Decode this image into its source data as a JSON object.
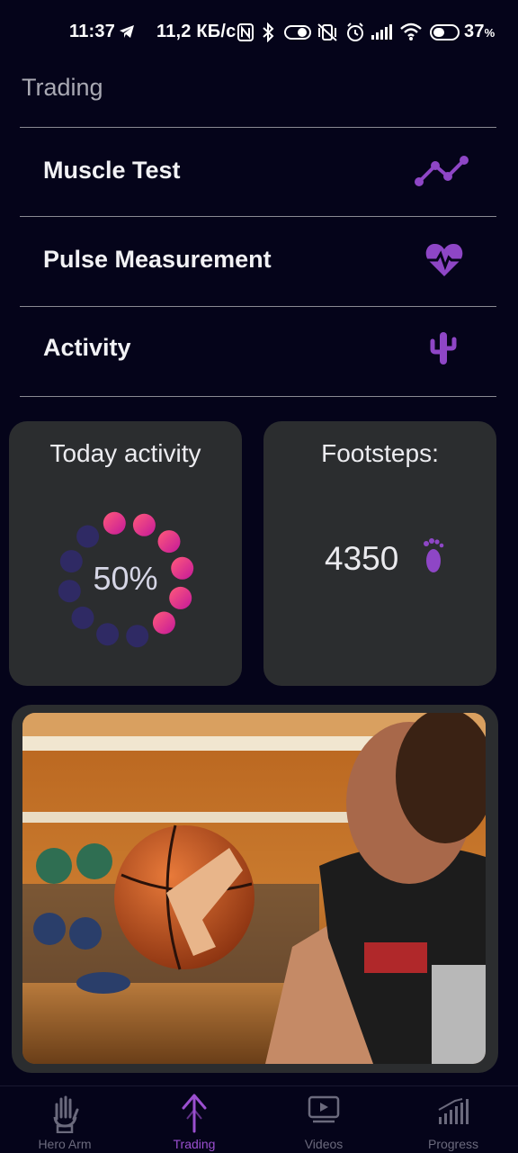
{
  "status_bar": {
    "time": "11:37",
    "network_speed": "11,2 КБ/с",
    "battery": "37",
    "battery_unit": "%"
  },
  "section_title": "Trading",
  "menu": [
    {
      "label": "Muscle Test",
      "icon": "chart-line-icon"
    },
    {
      "label": "Pulse Measurement",
      "icon": "heart-pulse-icon"
    },
    {
      "label": "Activity",
      "icon": "cactus-icon"
    }
  ],
  "today_card": {
    "title": "Today activity",
    "value": "50%",
    "progress": 0.5
  },
  "steps_card": {
    "title": "Footsteps:",
    "value": "4350"
  },
  "photo": {
    "label": "basketball-player-prosthetic-hand-photo"
  },
  "nav": [
    {
      "label": "Hero Arm",
      "icon": "hand-icon",
      "active": false
    },
    {
      "label": "Trading",
      "icon": "arrow-up-icon",
      "active": true
    },
    {
      "label": "Videos",
      "icon": "video-play-icon",
      "active": false
    },
    {
      "label": "Progress",
      "icon": "bar-chart-icon",
      "active": false
    }
  ],
  "colors": {
    "background": "#05041a",
    "card": "#2b2d2f",
    "accent_purple": "#8e46c6",
    "ring_dim": "#2f2a64",
    "ring_gradient_start": "#ff5a7a",
    "ring_gradient_end": "#c4189a"
  }
}
